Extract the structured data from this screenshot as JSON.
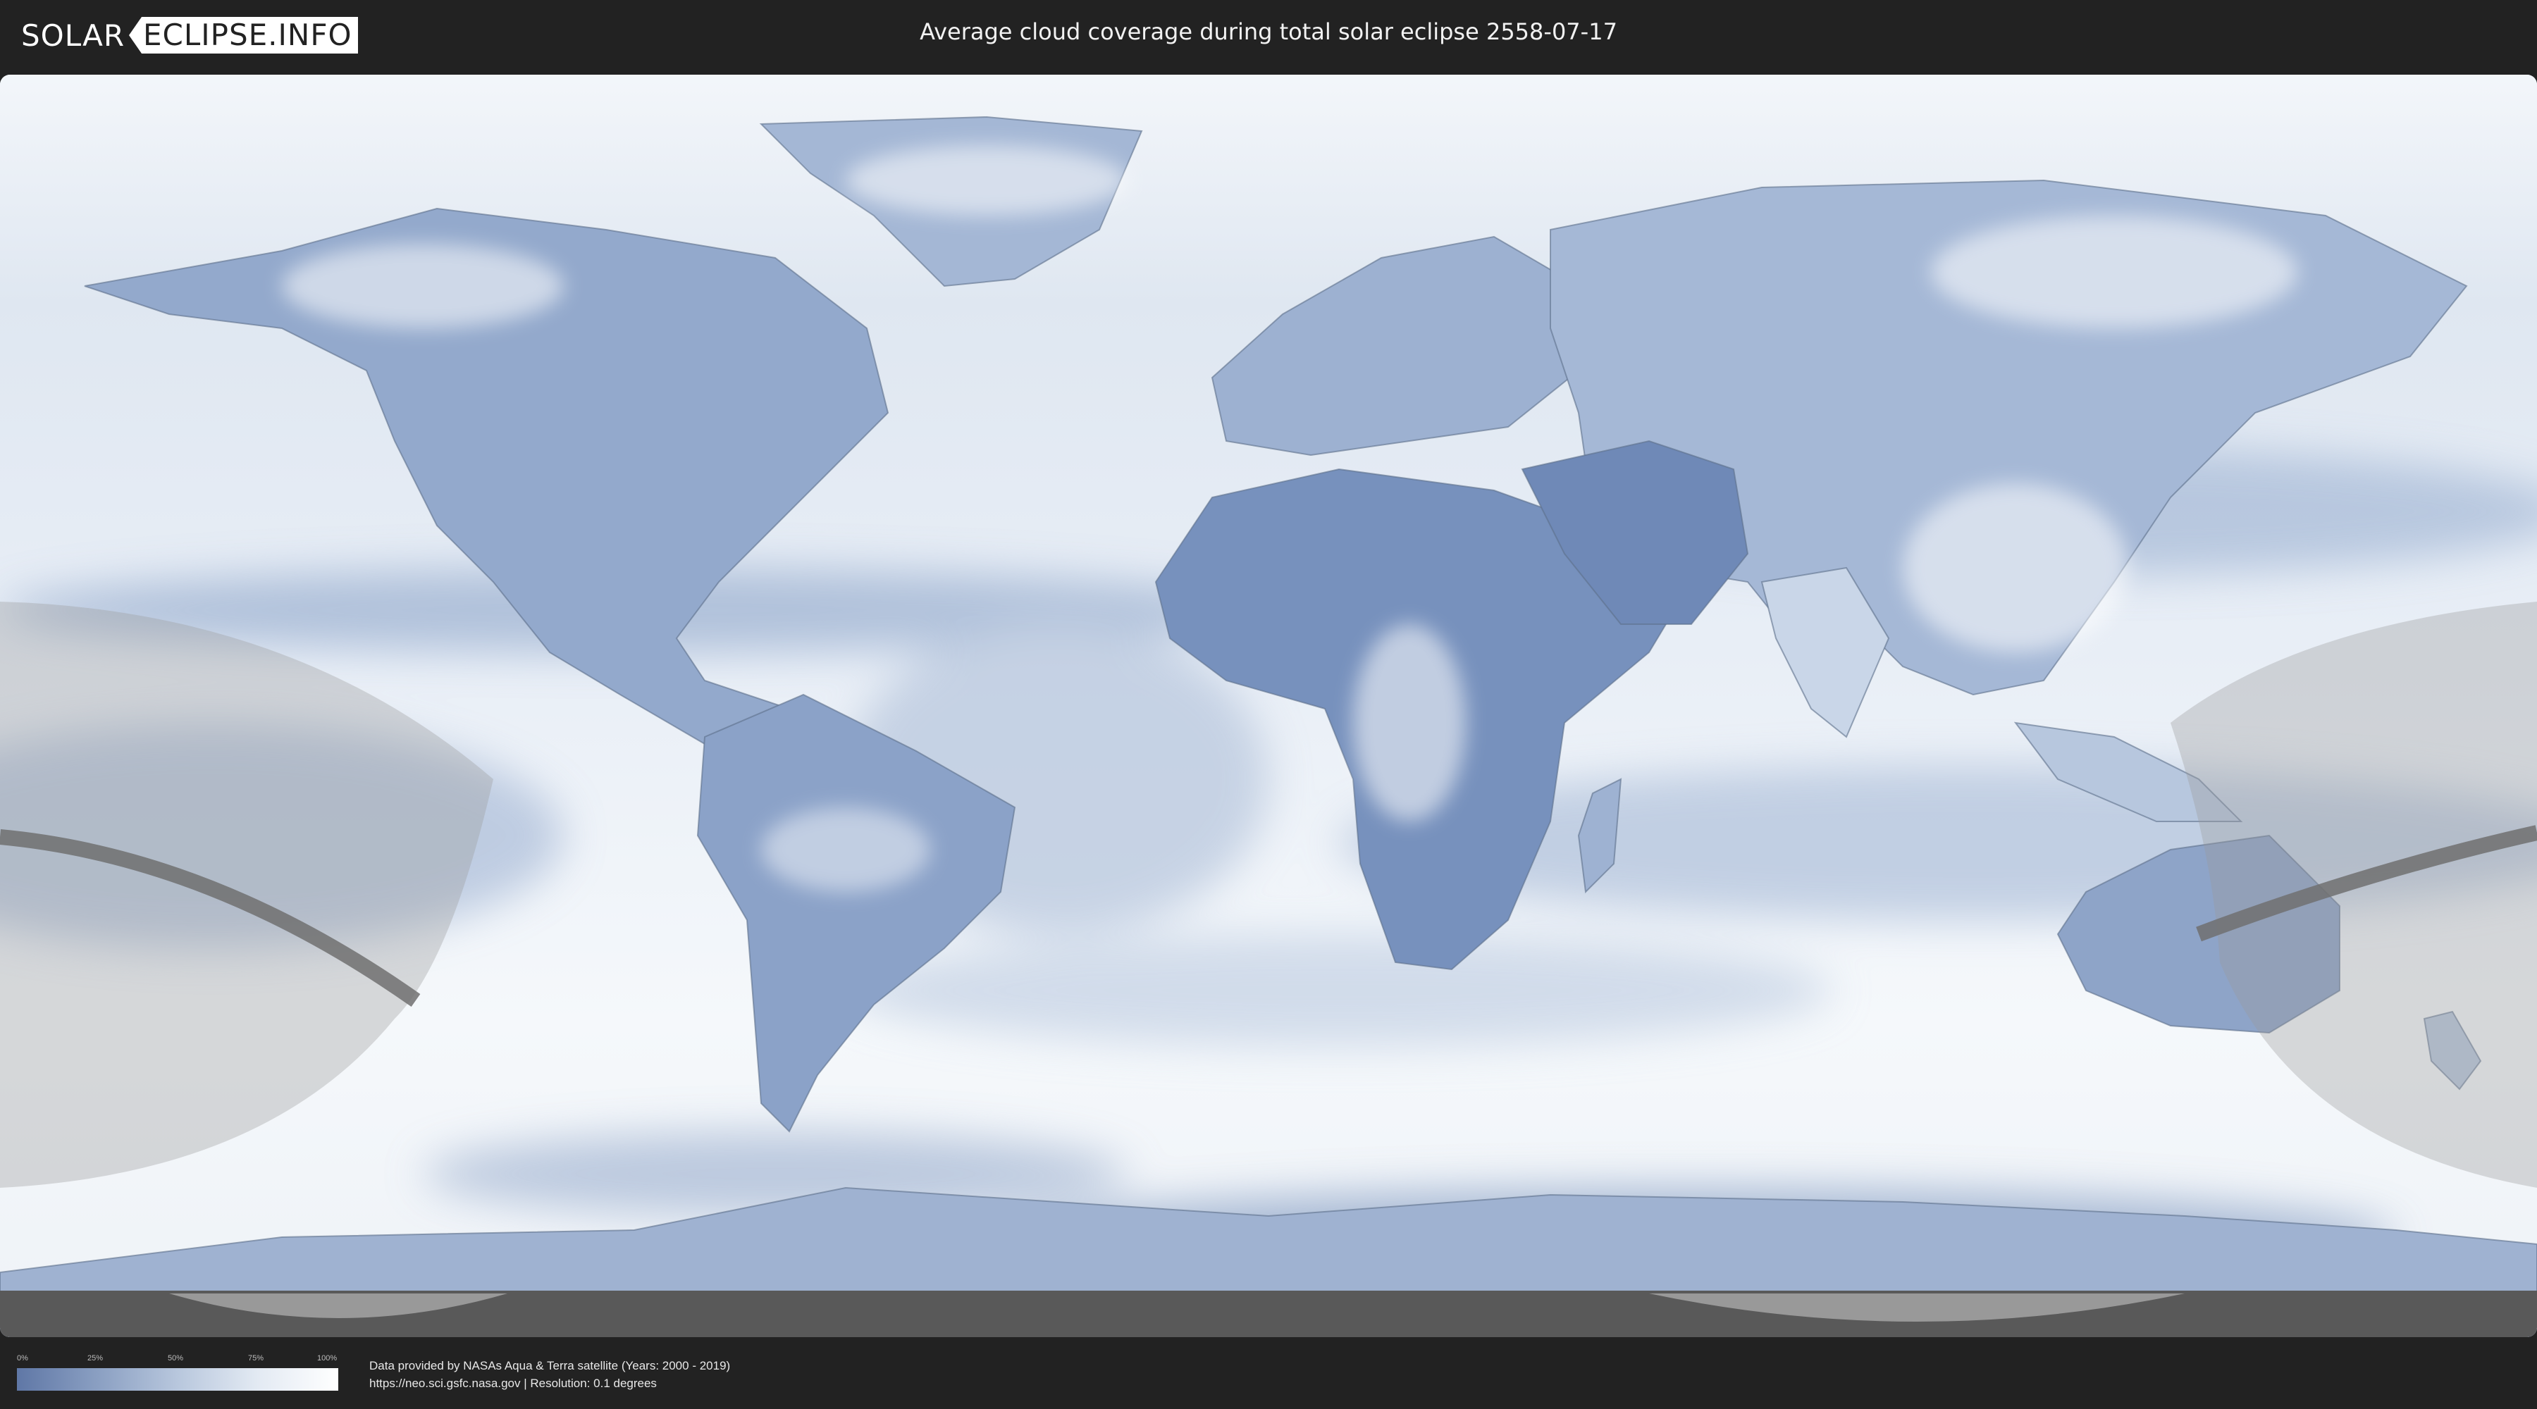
{
  "header": {
    "logo_left": "SOLAR",
    "logo_right": "ECLIPSE.INFO",
    "title": "Average cloud coverage during total solar eclipse 2558-07-17"
  },
  "map": {
    "colors": {
      "ocean_low_cloud": "#6f88b6",
      "clear": "#5c76a6",
      "cloudy": "#ffffff",
      "penumbra_overlay": "#b0b0b0",
      "totality_path": "#666666"
    }
  },
  "legend": {
    "ticks": [
      "0%",
      "25%",
      "50%",
      "75%",
      "100%"
    ]
  },
  "footer": {
    "credit_line1": "Data provided by NASAs Aqua & Terra satellite (Years: 2000 - 2019)",
    "credit_line2": "https://neo.sci.gsfc.nasa.gov | Resolution: 0.1 degrees"
  }
}
